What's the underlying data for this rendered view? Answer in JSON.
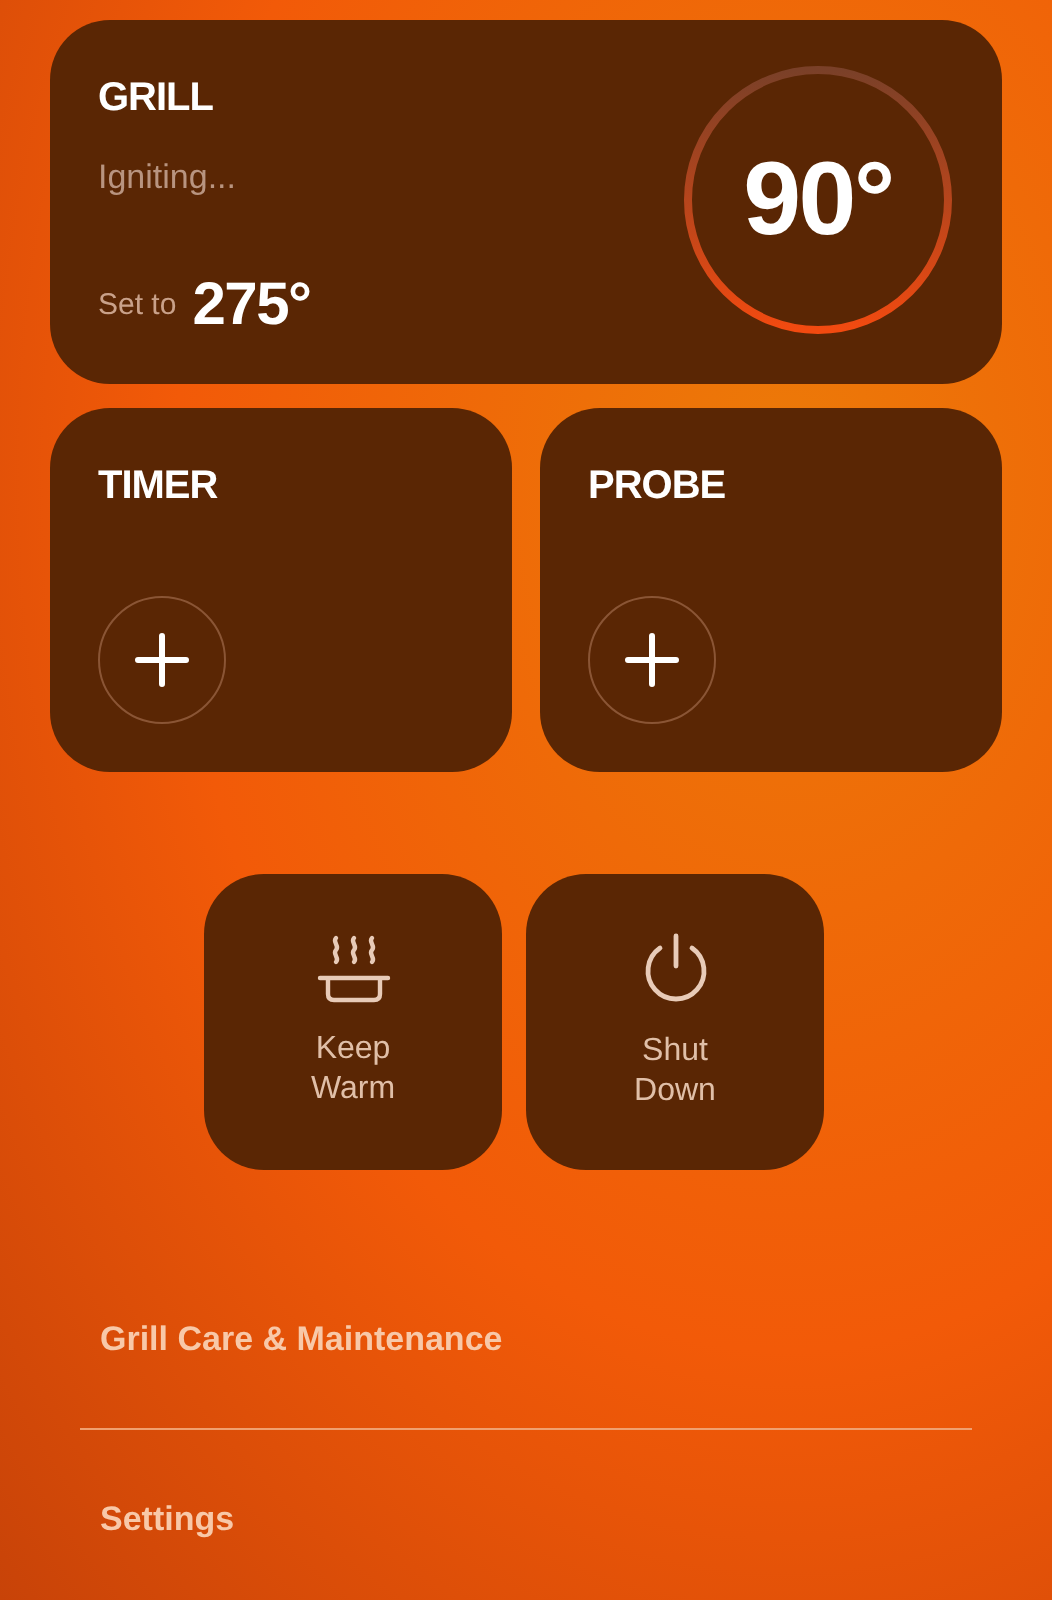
{
  "grill": {
    "title": "GRILL",
    "status": "Igniting...",
    "set_label": "Set to",
    "set_temp": "275°",
    "current_temp": "90°"
  },
  "cards": [
    {
      "title": "TIMER",
      "kind": "add"
    },
    {
      "title": "PROBE",
      "kind": "add"
    }
  ],
  "actions": [
    {
      "label": "Keep Warm",
      "kind": "warm"
    },
    {
      "label": "Shut Down",
      "kind": "power"
    }
  ],
  "menu": [
    "Grill Care & Maintenance",
    "Settings"
  ]
}
